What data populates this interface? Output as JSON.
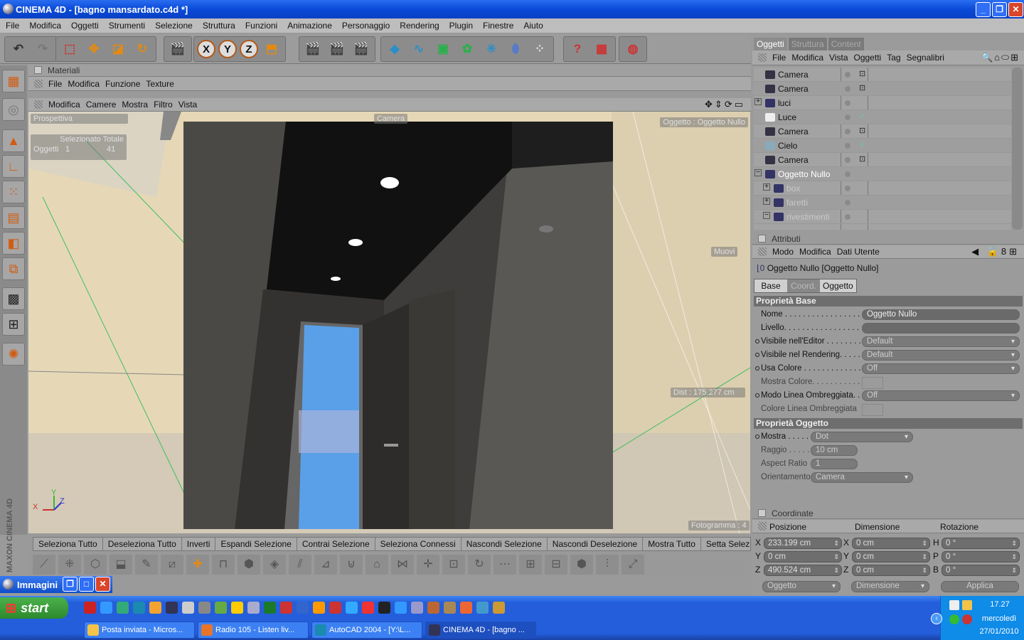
{
  "window": {
    "title": "CINEMA 4D - [bagno mansardato.c4d *]",
    "min": "_",
    "max": "❐",
    "close": "✕"
  },
  "menu": [
    "File",
    "Modifica",
    "Oggetti",
    "Strumenti",
    "Selezione",
    "Struttura",
    "Funzioni",
    "Animazione",
    "Personaggio",
    "Rendering",
    "Plugin",
    "Finestre",
    "Aiuto"
  ],
  "toolbar": {
    "axes": [
      "X",
      "Y",
      "Z"
    ]
  },
  "materials": {
    "title": "Materiali",
    "menu": [
      "File",
      "Modifica",
      "Funzione",
      "Texture"
    ]
  },
  "viewport": {
    "menu": [
      "Modifica",
      "Camere",
      "Mostra",
      "Filtro",
      "Vista"
    ],
    "view_name": "Prospettiva",
    "camera_label": "Camera",
    "object_label": "Oggetto : Oggetto Nullo",
    "stats_header": "Selezionato Totale",
    "stats_label": "Oggetti",
    "stats_selected": "1",
    "stats_total": "41",
    "move_label": "Muovi",
    "dist": "Dist : 175.277 cm",
    "frame": "Fotogramma : 4",
    "axis_x": "X",
    "axis_y": "Y",
    "axis_z": "Z"
  },
  "selection_bar": [
    "Seleziona Tutto",
    "Deseleziona Tutto",
    "Inverti",
    "Espandi Selezione",
    "Contrai Selezione",
    "Seleziona Connessi",
    "Nascondi Selezione",
    "Nascondi Deselezione",
    "Mostra Tutto",
    "Setta Selezione",
    "Converti Selez"
  ],
  "immagini": {
    "label": "Immagini"
  },
  "side_logo": "MAXON CINEMA 4D",
  "objects": {
    "tabs": [
      "Oggetti",
      "Struttura",
      "Content"
    ],
    "menu": [
      "File",
      "Modifica",
      "Vista",
      "Oggetti",
      "Tag",
      "Segnalibri"
    ],
    "items": [
      {
        "name": "Camera",
        "icon": "camera-icon",
        "depth": 0,
        "tag": "target"
      },
      {
        "name": "Camera",
        "icon": "camera-icon",
        "depth": 0,
        "tag": "target"
      },
      {
        "name": "luci",
        "icon": "null-icon",
        "depth": 0,
        "expand": "+"
      },
      {
        "name": "Luce",
        "icon": "light-icon",
        "depth": 0,
        "tag": "check"
      },
      {
        "name": "Camera",
        "icon": "camera-icon",
        "depth": 0,
        "tag": "target"
      },
      {
        "name": "Cielo",
        "icon": "sky-icon",
        "depth": 0,
        "tag": "check"
      },
      {
        "name": "Camera",
        "icon": "camera-icon",
        "depth": 0,
        "tag": "target"
      },
      {
        "name": "Oggetto Nullo",
        "icon": "null-icon",
        "depth": 0,
        "expand": "−",
        "selected": true
      },
      {
        "name": "box",
        "icon": "null-icon",
        "depth": 1,
        "expand": "+",
        "dim": true
      },
      {
        "name": "faretti",
        "icon": "null-icon",
        "depth": 1,
        "expand": "+",
        "dim": true
      },
      {
        "name": "rivestimenti",
        "icon": "null-icon",
        "depth": 1,
        "expand": "−",
        "dim": true
      }
    ]
  },
  "attributes": {
    "title": "Attributi",
    "menu": [
      "Modo",
      "Modifica",
      "Dati Utente"
    ],
    "object": "Oggetto Nullo [Oggetto Nullo]",
    "tabs": [
      "Base",
      "Coord.",
      "Oggetto"
    ],
    "base_section": "Proprietà Base",
    "base": [
      {
        "label": "Nome . . . . . . . . . . . . . . . . . .",
        "value": "Oggetto Nullo",
        "type": "text"
      },
      {
        "label": "Livello. . . . . . . . . . . . . . . . . .",
        "value": "",
        "type": "link"
      },
      {
        "label": "Visibile nell'Editor . . . . . . . . .",
        "value": "Default",
        "type": "dropdown",
        "dot": true
      },
      {
        "label": "Visibile nel Rendering. . . . . . .",
        "value": "Default",
        "type": "dropdown",
        "dot": true
      },
      {
        "label": "Usa Colore . . . . . . . . . . . . . .",
        "value": "Off",
        "type": "dropdown",
        "dot": true
      },
      {
        "label": "Mostra Colore. . . . . . . . . . .",
        "value": "",
        "type": "color"
      },
      {
        "label": "Modo Linea Ombreggiata. . .",
        "value": "Off",
        "type": "dropdown",
        "dot": true
      },
      {
        "label": "Colore Linea Ombreggiata",
        "value": "",
        "type": "color"
      }
    ],
    "object_section": "Proprietà Oggetto",
    "object_props": [
      {
        "label": "Mostra . . . . .",
        "value": "Dot",
        "type": "dropdown",
        "dot": true
      },
      {
        "label": "Raggio . . . . .",
        "value": "10 cm",
        "type": "spinner"
      },
      {
        "label": "Aspect Ratio",
        "value": "1",
        "type": "spinner"
      },
      {
        "label": "Orientamento",
        "value": "Camera",
        "type": "dropdown"
      }
    ]
  },
  "coordinates": {
    "title": "Coordinate",
    "headers": [
      "Posizione",
      "Dimensione",
      "Rotazione"
    ],
    "rows": [
      {
        "a": "X",
        "pos": "233.199 cm",
        "b": "X",
        "dim": "0 cm",
        "c": "H",
        "rot": "0 °"
      },
      {
        "a": "Y",
        "pos": "0 cm",
        "b": "Y",
        "dim": "0 cm",
        "c": "P",
        "rot": "0 °"
      },
      {
        "a": "Z",
        "pos": "490.524 cm",
        "b": "Z",
        "dim": "0 cm",
        "c": "B",
        "rot": "0 °"
      }
    ],
    "mode1": "Oggetto",
    "mode2": "Dimensione",
    "apply": "Applica"
  },
  "taskbar": {
    "start": "start",
    "tasks": [
      "Posta inviata - Micros...",
      "Radio 105 - Listen liv...",
      "AutoCAD 2004 - [Y:\\L...",
      "CINEMA 4D - [bagno ..."
    ],
    "time": "17.27",
    "day": "mercoledì",
    "date": "27/01/2010"
  }
}
